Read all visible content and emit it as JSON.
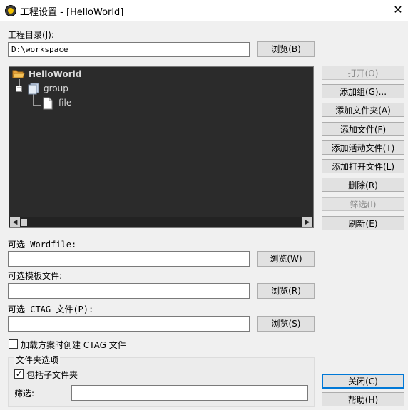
{
  "window": {
    "title": "工程设置 - [HelloWorld]",
    "close_label": "✕"
  },
  "project_dir": {
    "label": "工程目录(J):",
    "value": "D:\\workspace",
    "browse_label": "浏览(B)"
  },
  "tree": {
    "root": "HelloWorld",
    "group": "group",
    "file": "file",
    "expander": "−"
  },
  "side_buttons": {
    "open": "打开(O)",
    "add_group": "添加组(G)...",
    "add_folder": "添加文件夹(A)",
    "add_file": "添加文件(F)",
    "add_active_file": "添加活动文件(T)",
    "add_open_files": "添加打开文件(L)",
    "delete": "删除(R)",
    "filter": "筛选(I)",
    "refresh": "刷新(E)"
  },
  "wordfile": {
    "label": "可选 Wordfile:",
    "value": "",
    "browse_label": "浏览(W)"
  },
  "template": {
    "label": "可选模板文件:",
    "value": "",
    "browse_label": "浏览(R)"
  },
  "ctag": {
    "label": "可选 CTAG 文件(P):",
    "value": "",
    "browse_label": "浏览(S)"
  },
  "create_ctag": {
    "label": "加载方案时创建 CTAG 文件",
    "checked": false
  },
  "folder_options": {
    "title": "文件夹选项",
    "include_subfolders_label": "包括子文件夹",
    "include_subfolders_checked": true,
    "filter_label": "筛选:",
    "filter_value": ""
  },
  "footer": {
    "close_label": "关闭(C)",
    "help_label": "帮助(H)"
  }
}
